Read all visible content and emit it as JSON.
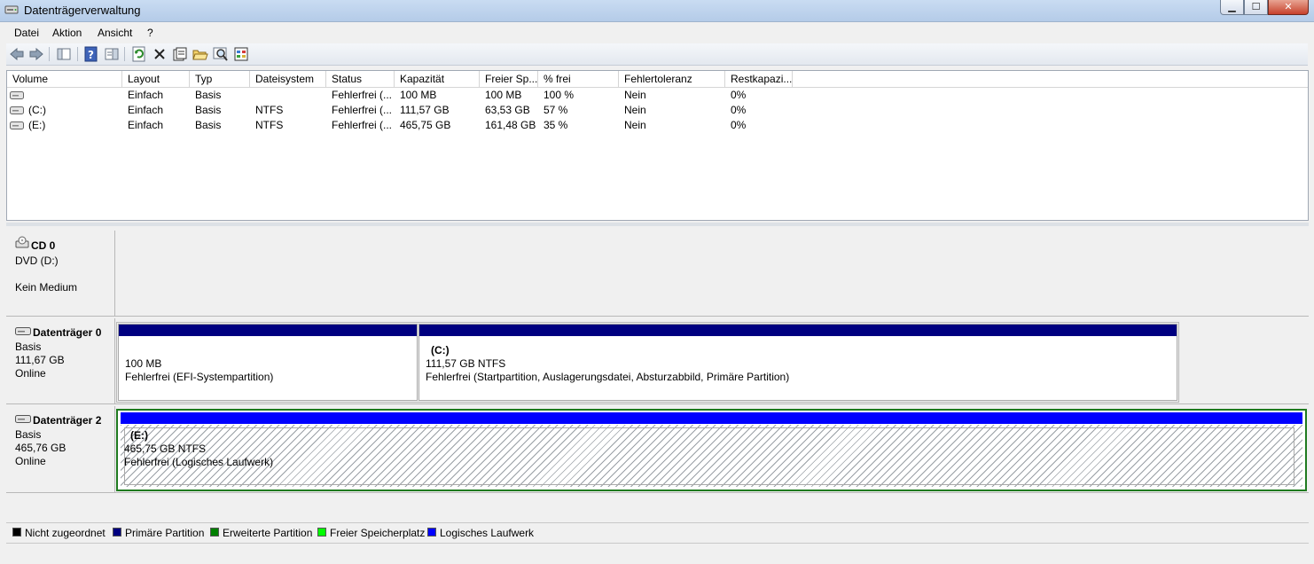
{
  "window": {
    "title": "Datenträgerverwaltung"
  },
  "menu": [
    "Datei",
    "Aktion",
    "Ansicht",
    "?"
  ],
  "columns": [
    "Volume",
    "Layout",
    "Typ",
    "Dateisystem",
    "Status",
    "Kapazität",
    "Freier Sp...",
    "% frei",
    "Fehlertoleranz",
    "Restkapazi..."
  ],
  "volumes": [
    {
      "volume": "",
      "layout": "Einfach",
      "typ": "Basis",
      "dateisystem": "",
      "status": "Fehlerfrei (...",
      "kapazitaet": "100 MB",
      "frei": "100 MB",
      "prozent": "100 %",
      "fehlertoleranz": "Nein",
      "rest": "0%"
    },
    {
      "volume": "(C:)",
      "layout": "Einfach",
      "typ": "Basis",
      "dateisystem": "NTFS",
      "status": "Fehlerfrei (...",
      "kapazitaet": "111,57 GB",
      "frei": "63,53 GB",
      "prozent": "57 %",
      "fehlertoleranz": "Nein",
      "rest": "0%"
    },
    {
      "volume": "(E:)",
      "layout": "Einfach",
      "typ": "Basis",
      "dateisystem": "NTFS",
      "status": "Fehlerfrei (...",
      "kapazitaet": "465,75 GB",
      "frei": "161,48 GB",
      "prozent": "35 %",
      "fehlertoleranz": "Nein",
      "rest": "0%"
    }
  ],
  "disks": {
    "cd0": {
      "name": "CD 0",
      "type": "DVD (D:)",
      "status": "Kein Medium"
    },
    "disk0": {
      "name": "Datenträger 0",
      "type": "Basis",
      "size": "111,67 GB",
      "status": "Online",
      "partitions": [
        {
          "label": "",
          "size": "100 MB",
          "status": "Fehlerfrei (EFI-Systempartition)"
        },
        {
          "label": "(C:)",
          "size": "111,57 GB NTFS",
          "status": "Fehlerfrei (Startpartition, Auslagerungsdatei, Absturzabbild, Primäre Partition)"
        }
      ]
    },
    "disk2": {
      "name": "Datenträger 2",
      "type": "Basis",
      "size": "465,76 GB",
      "status": "Online",
      "partitions": [
        {
          "label": "(E:)",
          "size": "465,75 GB NTFS",
          "status": "Fehlerfrei (Logisches Laufwerk)"
        }
      ]
    }
  },
  "legend": [
    {
      "label": "Nicht zugeordnet",
      "color": "#000000"
    },
    {
      "label": "Primäre Partition",
      "color": "#000080"
    },
    {
      "label": "Erweiterte Partition",
      "color": "#008000"
    },
    {
      "label": "Freier Speicherplatz",
      "color": "#00ff00"
    },
    {
      "label": "Logisches Laufwerk",
      "color": "#0000ff"
    }
  ],
  "colors": {
    "primary": "#000080",
    "extended": "#1f7a1f",
    "logical": "#0000ff"
  },
  "toolbar_icons": [
    "back-icon",
    "forward-icon",
    "console-tree-icon",
    "help-icon",
    "properties-pane-icon",
    "refresh-icon",
    "delete-icon",
    "properties-icon",
    "open-icon",
    "search-icon",
    "settings-icon"
  ]
}
